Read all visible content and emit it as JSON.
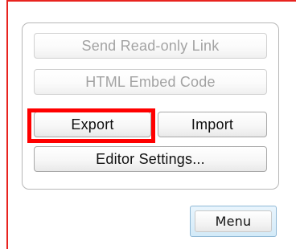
{
  "menu": {
    "send_read_only_link": "Send Read-only Link",
    "html_embed_code": "HTML Embed Code",
    "export": "Export",
    "import": "Import",
    "editor_settings": "Editor Settings..."
  },
  "menu_button_label": "Menu",
  "colors": {
    "highlight": "#ff0000",
    "frame_line": "#e8231f",
    "menu_button_accent": "#d3eaf8",
    "disabled_text": "#a3a3a3"
  },
  "states": {
    "send_read_only_link_enabled": false,
    "html_embed_code_enabled": false,
    "export_highlighted": true
  }
}
